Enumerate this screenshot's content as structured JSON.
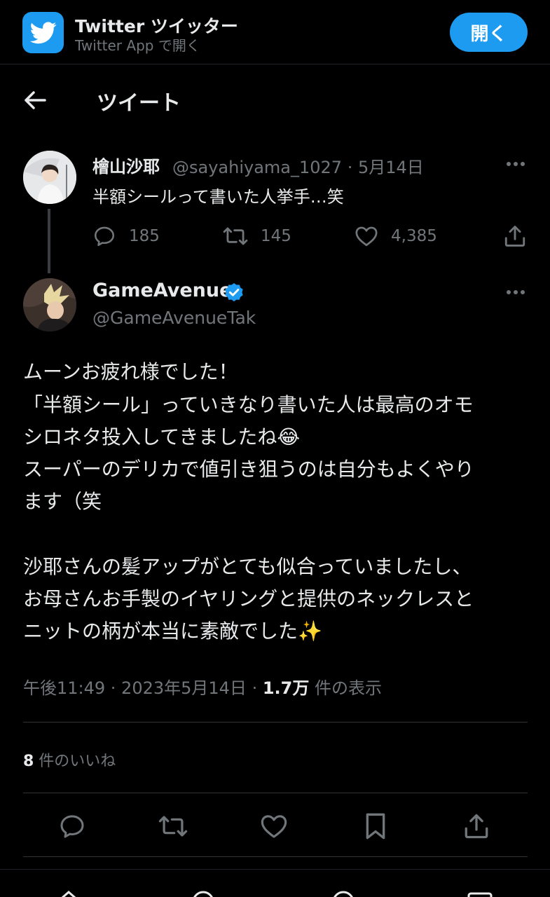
{
  "banner": {
    "app_name": "Twitter ツイッター",
    "subtitle": "Twitter App で開く",
    "open_label": "開く",
    "icon": "twitter-bird-icon"
  },
  "header": {
    "title": "ツイート",
    "back_icon": "arrow-left-icon"
  },
  "parent_tweet": {
    "name": "檜山沙耶",
    "handle_date": "@sayahiyama_1027 · 5月14日",
    "text": "半額シールって書いた人挙手…笑",
    "replies": "185",
    "retweets": "145",
    "likes": "4,385"
  },
  "main_tweet": {
    "name": "GameAvenue",
    "handle": "@GameAvenueTak",
    "lines": [
      "ムーンお疲れ様でした！",
      "「半額シール」っていきなり書いた人は最高のオモ",
      "シロネタ投入してきましたね😂",
      "スーパーのデリカで値引き狙うのは自分もよくやり",
      "ます（笑",
      "沙耶さんの髪アップがとても似合っていましたし、",
      "お母さんお手製のイヤリングと提供のネックレスと",
      "ニットの柄が本当に素敵でした✨"
    ],
    "time": "午後11:49 · 2023年5月14日 · ",
    "views_count": "1.7万",
    "views_label": " 件の表示",
    "likes_count": "8",
    "likes_label": " 件のいいね"
  },
  "colors": {
    "accent": "#1d9bf0",
    "background": "#000000",
    "muted": "#71767b"
  }
}
